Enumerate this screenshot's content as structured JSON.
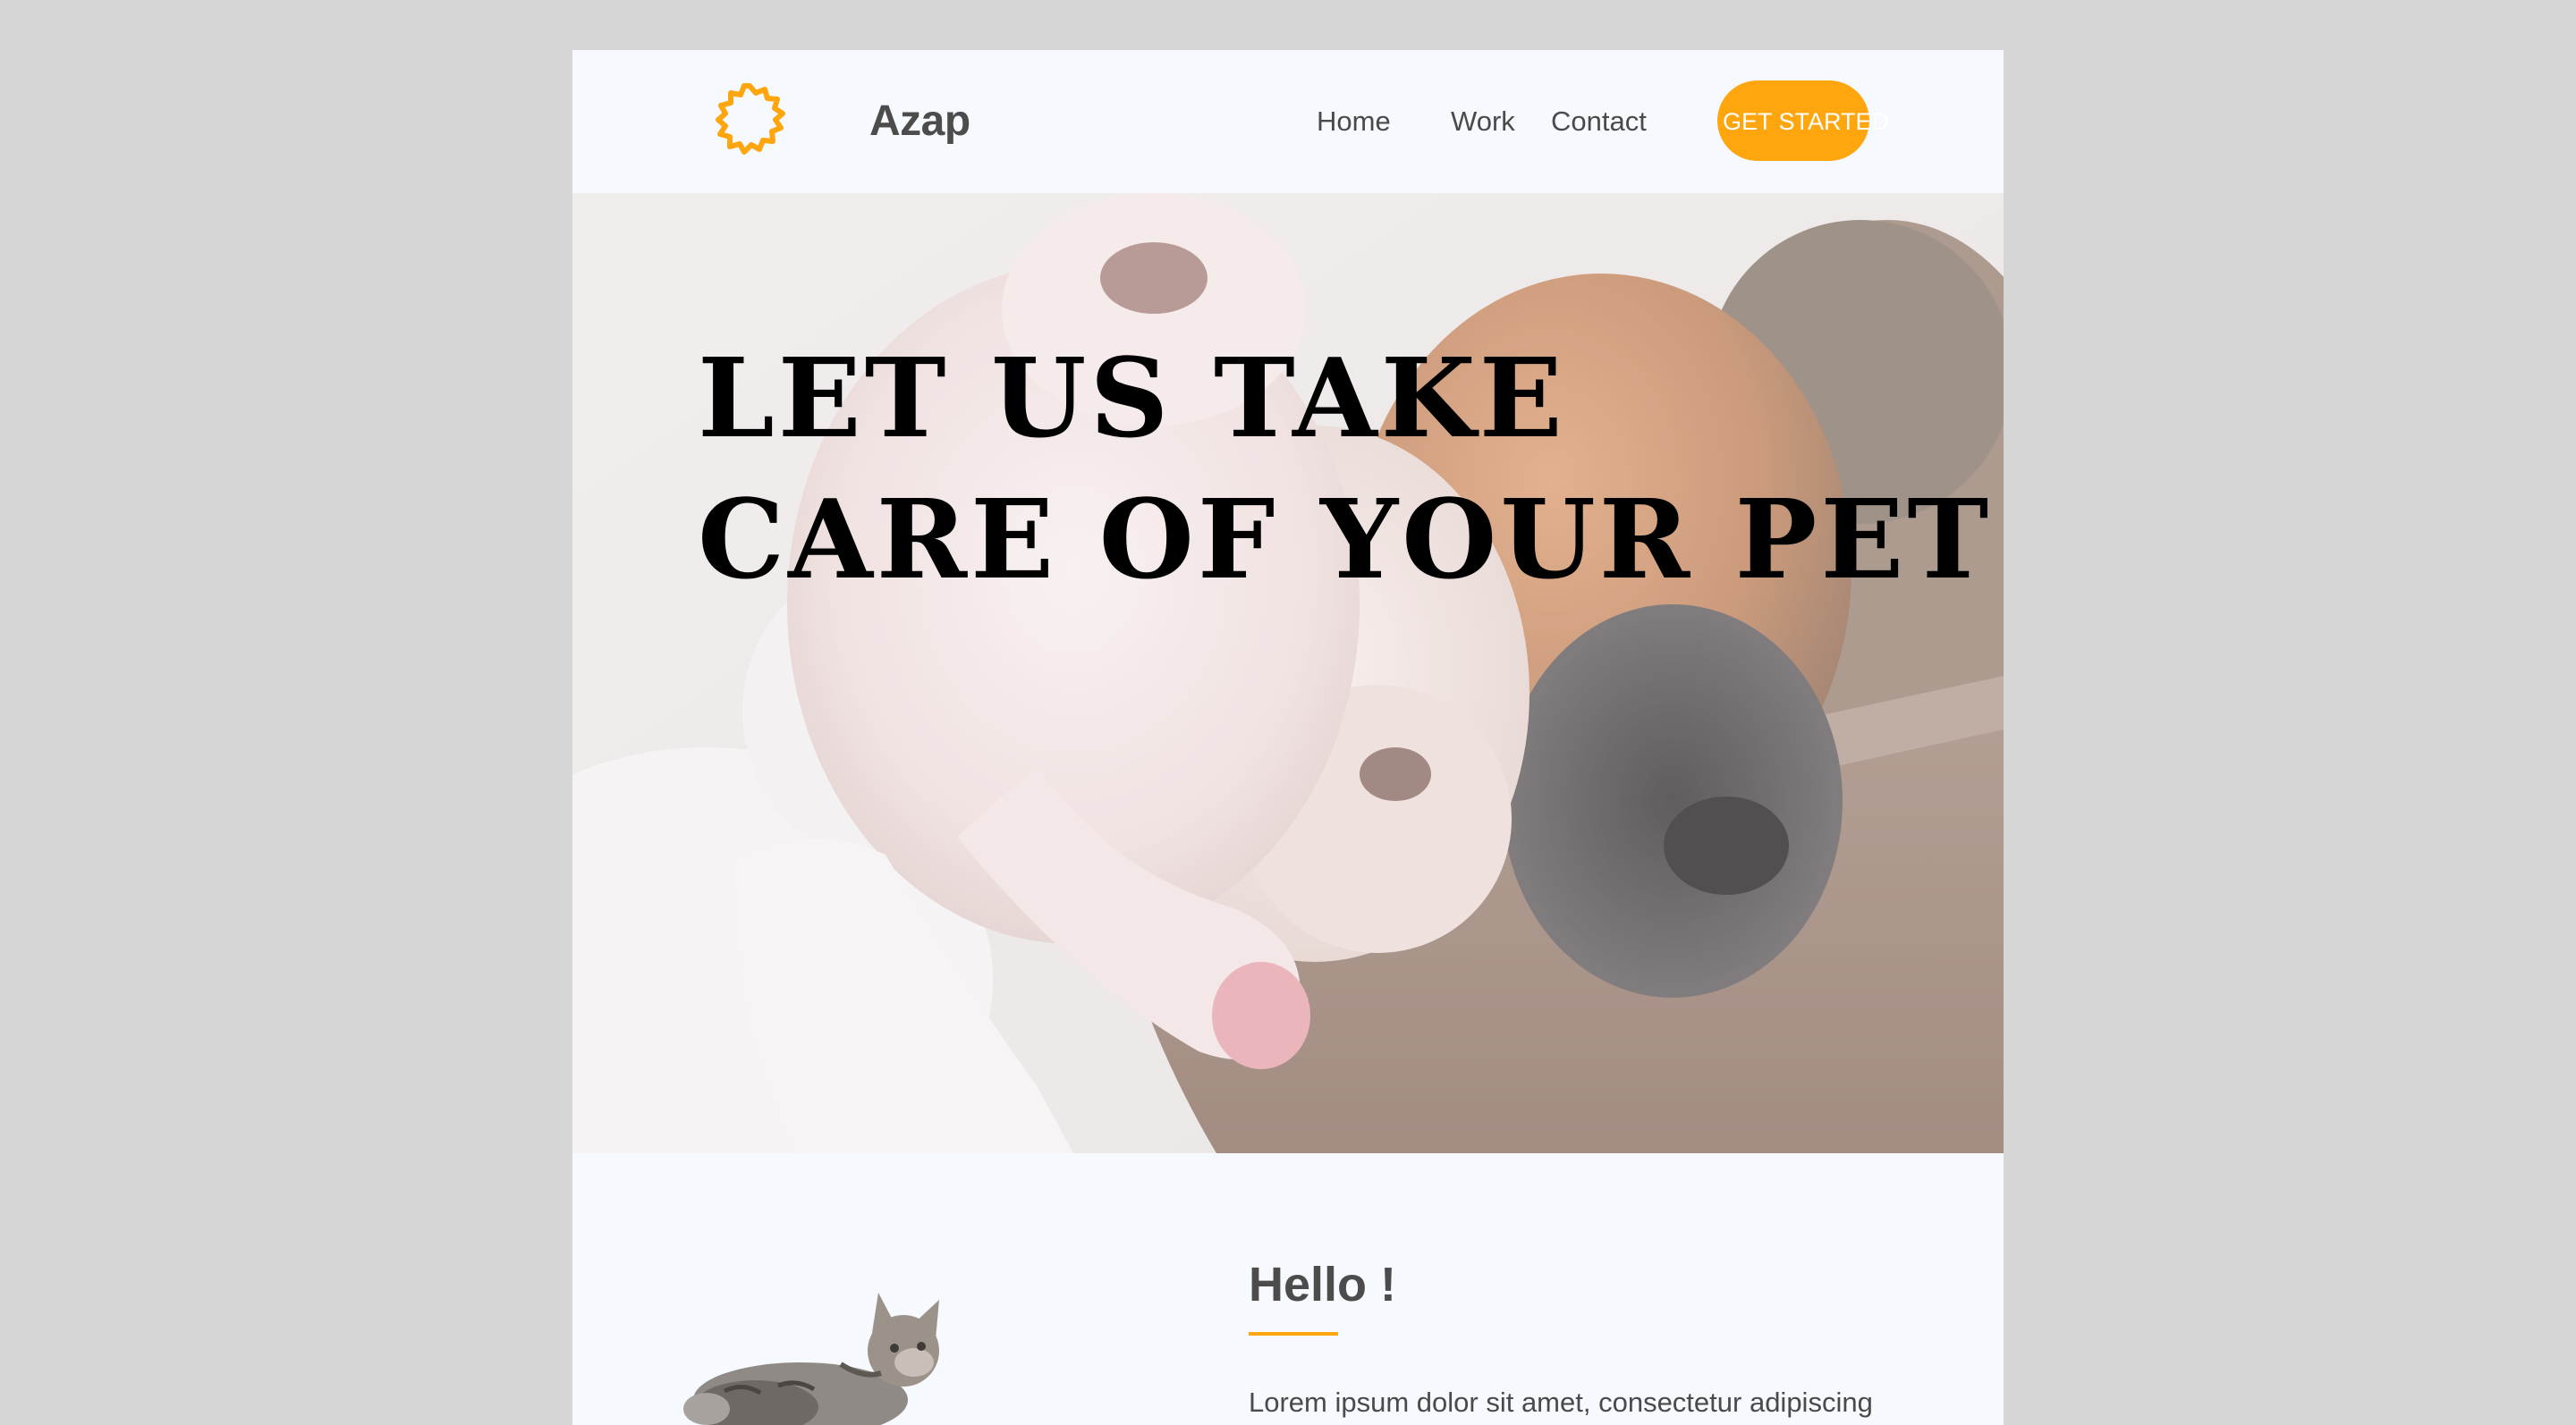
{
  "header": {
    "brand": "Azap",
    "nav": [
      {
        "label": "Home"
      },
      {
        "label": "Work"
      },
      {
        "label": "Contact"
      }
    ],
    "cta_label": "GET STARTED"
  },
  "hero": {
    "title_lines": [
      "LET US TAKE",
      "CARE OF YOUR PET"
    ],
    "image_alt": "puppies sleeping in a bowl"
  },
  "intro": {
    "title": "Hello !",
    "text": "Lorem ipsum dolor sit amet, consectetur adipiscing",
    "image_alt": "cat"
  },
  "colors": {
    "accent": "#ffa50d",
    "page_bg": "#f6f9fd",
    "outer_bg": "#d6d6d6",
    "text": "#4c4c4c"
  },
  "icons": [
    "sun-logo-icon"
  ]
}
